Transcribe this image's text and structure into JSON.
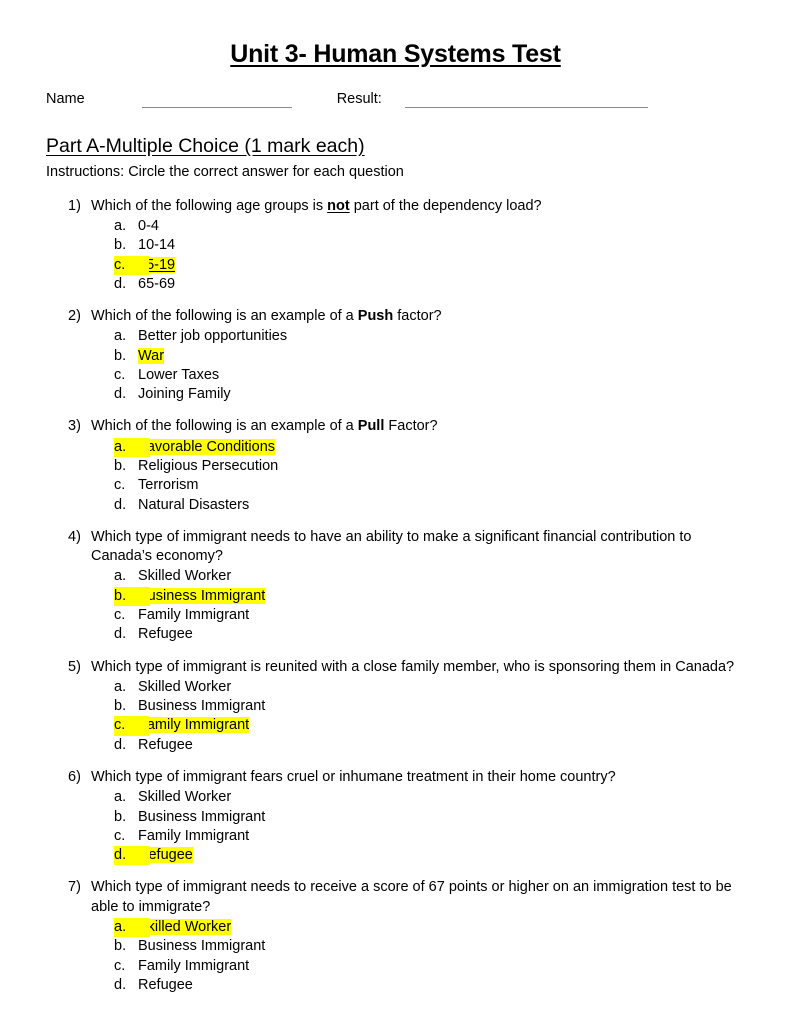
{
  "document": {
    "title": "Unit 3- Human Systems Test",
    "name_label": "Name",
    "result_label": "Result:",
    "part_heading": "Part A-Multiple Choice (1 mark each)",
    "instructions": "Instructions:  Circle the correct answer for each question",
    "highlight_color": "#ffff00"
  },
  "questions": [
    {
      "number": "1)",
      "text_before": "Which of the following age groups is ",
      "emphasis": "not",
      "emphasis_style": "bold-underline",
      "text_after": " part of the dependency load?",
      "full_text": "Which of the following age groups is not part of the dependency load?",
      "options": [
        {
          "letter": "a.",
          "text": "0-4",
          "highlight": "none"
        },
        {
          "letter": "b.",
          "text": "10-14",
          "highlight": "none"
        },
        {
          "letter": "c.",
          "text": "15-19",
          "highlight": "full",
          "underline": true
        },
        {
          "letter": "d.",
          "text": "65-69",
          "highlight": "none"
        }
      ]
    },
    {
      "number": "2)",
      "text_before": "Which of the following is an example of a ",
      "emphasis": "Push",
      "emphasis_style": "bold",
      "text_after": " factor?",
      "full_text": "Which of the following is an example of a Push factor?",
      "options": [
        {
          "letter": "a.",
          "text": "Better job opportunities",
          "highlight": "none"
        },
        {
          "letter": "b.",
          "text": "War",
          "highlight": "text"
        },
        {
          "letter": "c.",
          "text": "Lower Taxes",
          "highlight": "none"
        },
        {
          "letter": "d.",
          "text": "Joining Family",
          "highlight": "none"
        }
      ]
    },
    {
      "number": "3)",
      "text_before": "Which of the following is an example of a ",
      "emphasis": "Pull",
      "emphasis_style": "bold",
      "text_after": " Factor?",
      "full_text": "Which of the following is an example of a Pull Factor?",
      "options": [
        {
          "letter": "a.",
          "text": "Favorable Conditions",
          "highlight": "full"
        },
        {
          "letter": "b.",
          "text": "Religious Persecution",
          "highlight": "none"
        },
        {
          "letter": "c.",
          "text": "Terrorism",
          "highlight": "none"
        },
        {
          "letter": "d.",
          "text": "Natural Disasters",
          "highlight": "none"
        }
      ]
    },
    {
      "number": "4)",
      "text_before": "Which type of immigrant needs to have an ability to make a significant financial contribution to Canada’s economy?",
      "emphasis": "",
      "emphasis_style": "none",
      "text_after": "",
      "full_text": "Which type of immigrant needs to have an ability to make a significant financial contribution to Canada’s economy?",
      "options": [
        {
          "letter": "a.",
          "text": "Skilled Worker",
          "highlight": "none"
        },
        {
          "letter": "b.",
          "text": "Business Immigrant",
          "highlight": "full"
        },
        {
          "letter": "c.",
          "text": "Family Immigrant",
          "highlight": "none"
        },
        {
          "letter": "d.",
          "text": "Refugee",
          "highlight": "none"
        }
      ]
    },
    {
      "number": "5)",
      "text_before": "Which type of immigrant is reunited with a close family member, who is sponsoring them in Canada?",
      "emphasis": "",
      "emphasis_style": "none",
      "text_after": "",
      "full_text": "Which type of immigrant is reunited with a close family member, who is sponsoring them in Canada?",
      "options": [
        {
          "letter": "a.",
          "text": "Skilled Worker",
          "highlight": "none"
        },
        {
          "letter": "b.",
          "text": "Business Immigrant",
          "highlight": "none"
        },
        {
          "letter": "c.",
          "text": "Family Immigrant",
          "highlight": "full"
        },
        {
          "letter": "d.",
          "text": "Refugee",
          "highlight": "none"
        }
      ]
    },
    {
      "number": "6)",
      "text_before": "Which type of immigrant fears cruel or inhumane treatment in their home country?",
      "emphasis": "",
      "emphasis_style": "none",
      "text_after": "",
      "full_text": "Which type of immigrant fears cruel or inhumane treatment in their home country?",
      "options": [
        {
          "letter": "a.",
          "text": "Skilled Worker",
          "highlight": "none"
        },
        {
          "letter": "b.",
          "text": "Business Immigrant",
          "highlight": "none"
        },
        {
          "letter": "c.",
          "text": "Family Immigrant",
          "highlight": "none"
        },
        {
          "letter": "d.",
          "text": "Refugee",
          "highlight": "full"
        }
      ]
    },
    {
      "number": "7)",
      "text_before": "Which type of immigrant needs to receive a score of 67 points or higher on an immigration test to be able to immigrate?",
      "emphasis": "",
      "emphasis_style": "none",
      "text_after": "",
      "full_text": "Which type of immigrant needs to receive a score of 67 points or higher on an immigration test to be able to immigrate?",
      "options": [
        {
          "letter": "a.",
          "text": "Skilled Worker",
          "highlight": "full"
        },
        {
          "letter": "b.",
          "text": "Business Immigrant",
          "highlight": "none"
        },
        {
          "letter": "c.",
          "text": "Family Immigrant",
          "highlight": "none"
        },
        {
          "letter": "d.",
          "text": "Refugee",
          "highlight": "none"
        }
      ]
    }
  ]
}
